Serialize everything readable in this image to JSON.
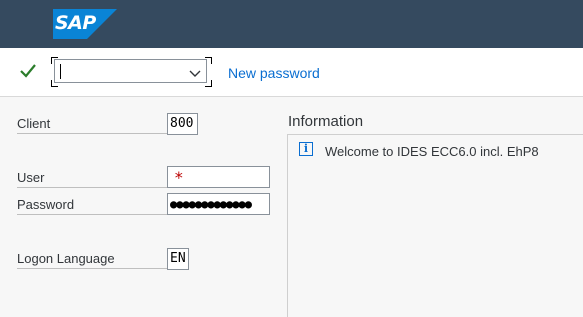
{
  "header": {
    "logo_text": "SAP",
    "background_color": "#354a5f"
  },
  "toolbar": {
    "confirm_icon": "check-icon",
    "command_field_value": "",
    "new_password_label": "New password",
    "link_color": "#0a6ed1"
  },
  "form": {
    "client": {
      "label": "Client",
      "value": "800"
    },
    "user": {
      "label": "User",
      "value": "",
      "required_marker": "*"
    },
    "password": {
      "label": "Password",
      "value_masked": "●●●●●●●●●●●●●"
    },
    "logon_language": {
      "label": "Logon Language",
      "value": "EN"
    }
  },
  "information": {
    "title": "Information",
    "icon": "info-icon",
    "icon_glyph": "i",
    "message": "Welcome to IDES ECC6.0 incl. EhP8"
  }
}
